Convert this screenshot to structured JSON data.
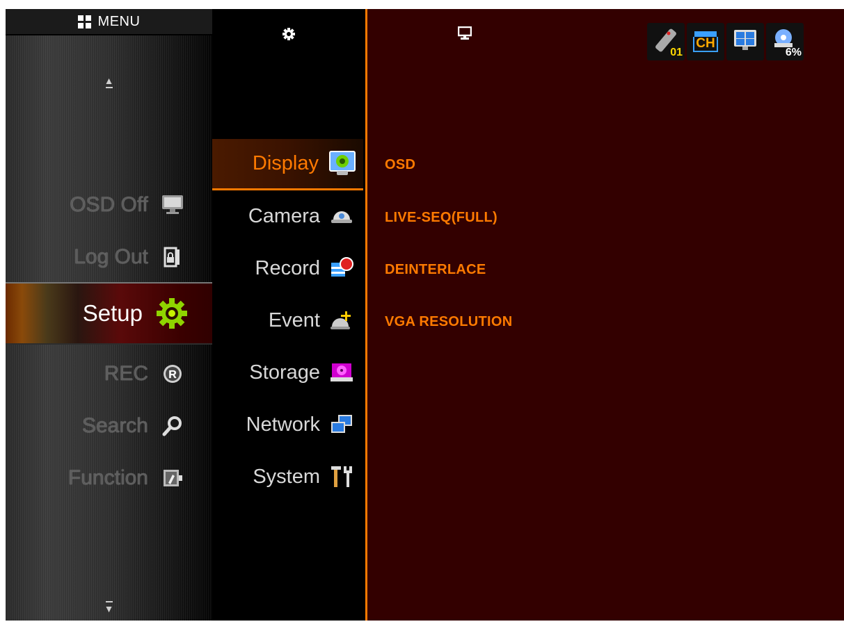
{
  "main_menu": {
    "title": "MENU",
    "items": [
      {
        "label": "OSD Off",
        "icon": "monitor-icon"
      },
      {
        "label": "Log Out",
        "icon": "logout-lock-icon"
      },
      {
        "label": "Setup",
        "icon": "gear-icon"
      },
      {
        "label": "REC",
        "icon": "record-r-icon"
      },
      {
        "label": "Search",
        "icon": "magnifier-icon"
      },
      {
        "label": "Function",
        "icon": "function-icon"
      }
    ],
    "active": "Setup"
  },
  "setup_menu": {
    "header_icon": "gear-icon",
    "items": [
      {
        "label": "Display",
        "icon": "display-settings-icon"
      },
      {
        "label": "Camera",
        "icon": "dome-camera-icon"
      },
      {
        "label": "Record",
        "icon": "record-icon"
      },
      {
        "label": "Event",
        "icon": "event-move-icon"
      },
      {
        "label": "Storage",
        "icon": "hdd-icon"
      },
      {
        "label": "Network",
        "icon": "network-icon"
      },
      {
        "label": "System",
        "icon": "tools-icon"
      }
    ],
    "active": "Display"
  },
  "display_settings": {
    "header_icon": "monitor-icon",
    "items": [
      "OSD",
      "LIVE-SEQ(FULL)",
      "DEINTERLACE",
      "VGA RESOLUTION"
    ]
  },
  "status_bar": {
    "remote_id": "01",
    "channel": "CH",
    "hdd_usage": "6%"
  },
  "colors": {
    "accent": "#ff7a00",
    "detail_bg": "#330000",
    "menu_text_inactive": "#5d5d5d",
    "submenu_text": "#d8d8d8"
  }
}
